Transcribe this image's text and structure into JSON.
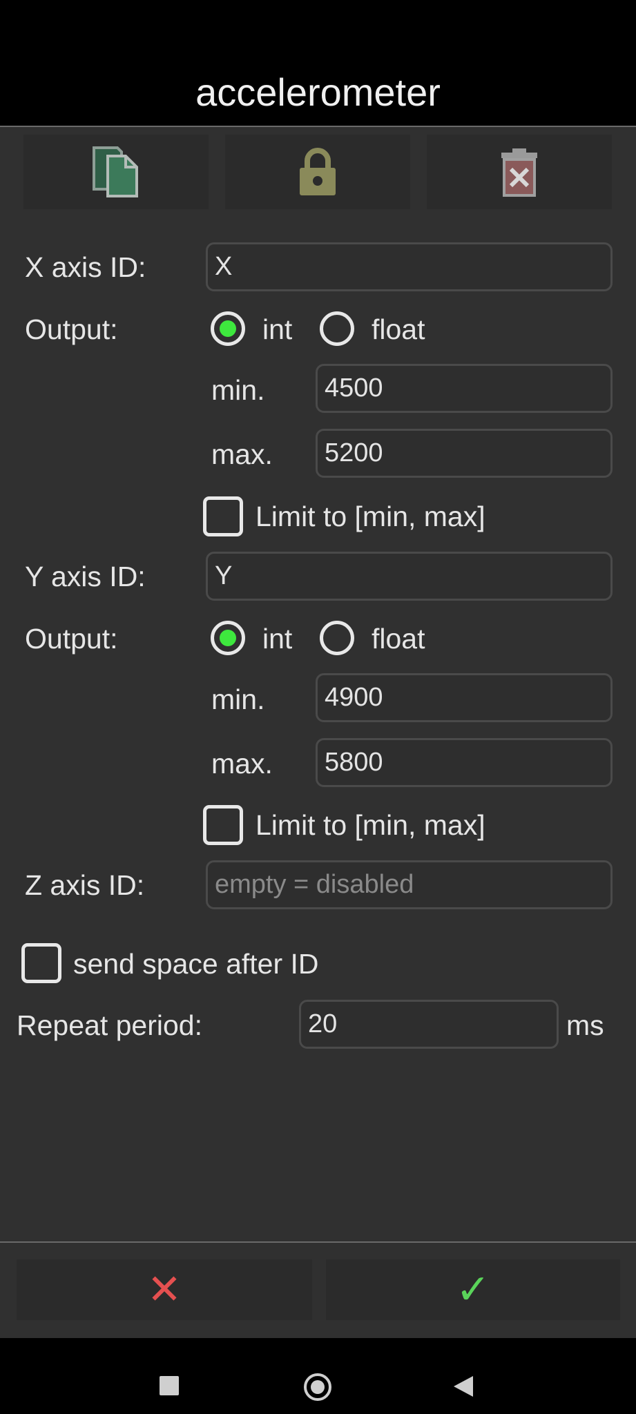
{
  "dialog": {
    "title": "accelerometer"
  },
  "toolbar": {
    "copy_icon": "copy-icon",
    "lock_icon": "lock-icon",
    "delete_icon": "trash-icon"
  },
  "x_axis": {
    "id_label": "X axis ID:",
    "id_value": "X",
    "output_label": "Output:",
    "output_options": [
      "int",
      "float"
    ],
    "output_selected": "int",
    "min_label": "min.",
    "min_value": "4500",
    "max_label": "max.",
    "max_value": "5200",
    "limit_label": "Limit to [min, max]",
    "limit_checked": false
  },
  "y_axis": {
    "id_label": "Y axis ID:",
    "id_value": "Y",
    "output_label": "Output:",
    "output_options": [
      "int",
      "float"
    ],
    "output_selected": "int",
    "min_label": "min.",
    "min_value": "4900",
    "max_label": "max.",
    "max_value": "5800",
    "limit_label": "Limit to [min, max]",
    "limit_checked": false
  },
  "z_axis": {
    "id_label": "Z axis ID:",
    "id_value": "",
    "id_placeholder": "empty = disabled"
  },
  "send_space": {
    "label": "send space after ID",
    "checked": false
  },
  "repeat": {
    "label": "Repeat period:",
    "value": "20",
    "unit": "ms"
  },
  "footer": {
    "cancel_glyph": "✕",
    "confirm_glyph": "✓"
  },
  "colors": {
    "radio_selected": "#3ee83e",
    "cancel": "#e55050",
    "confirm": "#5ad45a",
    "copy_icon": "#3c7a5a",
    "lock_icon": "#8a8a5a",
    "delete_icon": "#8a5a5a"
  }
}
